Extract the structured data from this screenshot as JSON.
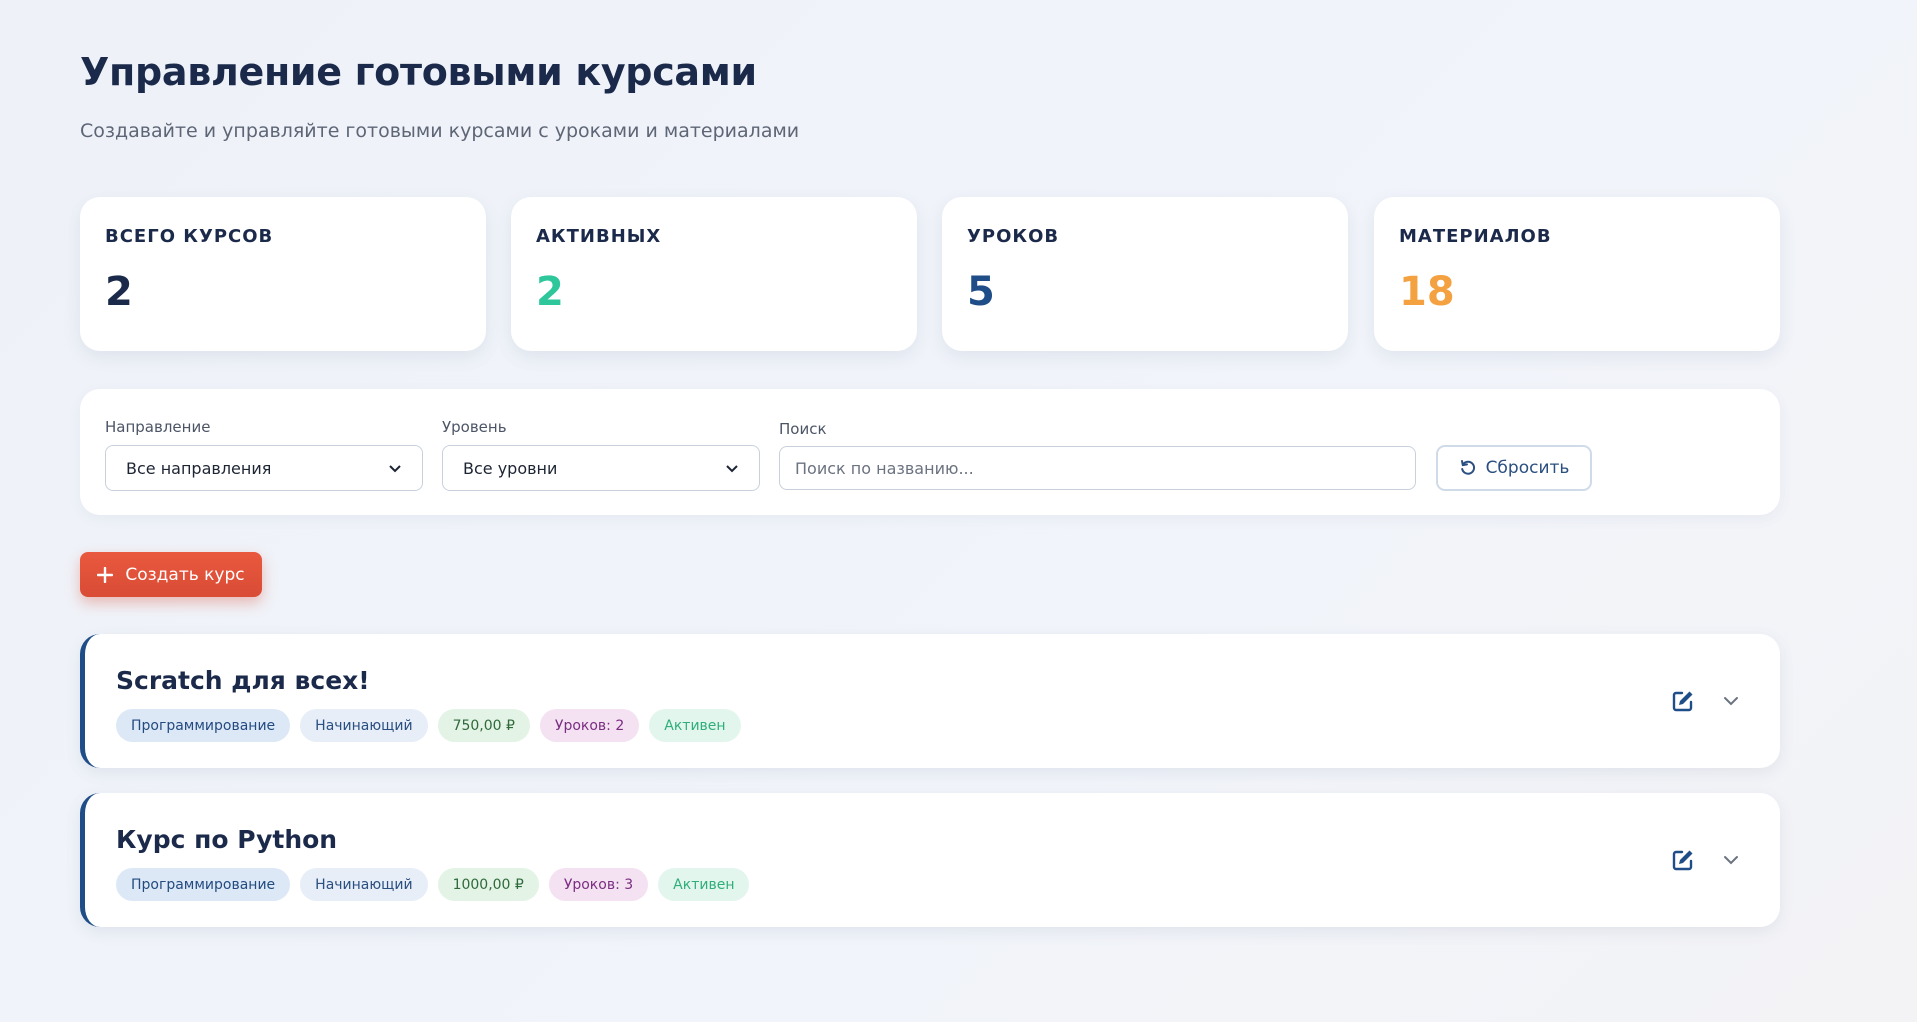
{
  "header": {
    "title": "Управление готовыми курсами",
    "subtitle": "Создавайте и управляйте готовыми курсами с уроками и материалами"
  },
  "stats": [
    {
      "label": "ВСЕГО КУРСОВ",
      "value": "2",
      "color": "#1b2a4a"
    },
    {
      "label": "АКТИВНЫХ",
      "value": "2",
      "color": "#2ec79b"
    },
    {
      "label": "УРОКОВ",
      "value": "5",
      "color": "#1e4d87"
    },
    {
      "label": "МАТЕРИАЛОВ",
      "value": "18",
      "color": "#f4a142"
    }
  ],
  "filters": {
    "direction": {
      "label": "Направление",
      "value": "Все направления"
    },
    "level": {
      "label": "Уровень",
      "value": "Все уровни"
    },
    "search": {
      "label": "Поиск",
      "placeholder": "Поиск по названию...",
      "value": ""
    },
    "reset_label": "Сбросить"
  },
  "create_button": {
    "label": "Создать курс"
  },
  "courses": [
    {
      "title": "Scratch для всех!",
      "direction": "Программирование",
      "level": "Начинающий",
      "price": "750,00 ₽",
      "lessons": "Уроков: 2",
      "status": "Активен"
    },
    {
      "title": "Курс по Python",
      "direction": "Программирование",
      "level": "Начинающий",
      "price": "1000,00 ₽",
      "lessons": "Уроков: 3",
      "status": "Активен"
    }
  ],
  "colors": {
    "accent": "#1e4d87",
    "create_button": "#e35540",
    "status_active": "#2ec79b"
  }
}
